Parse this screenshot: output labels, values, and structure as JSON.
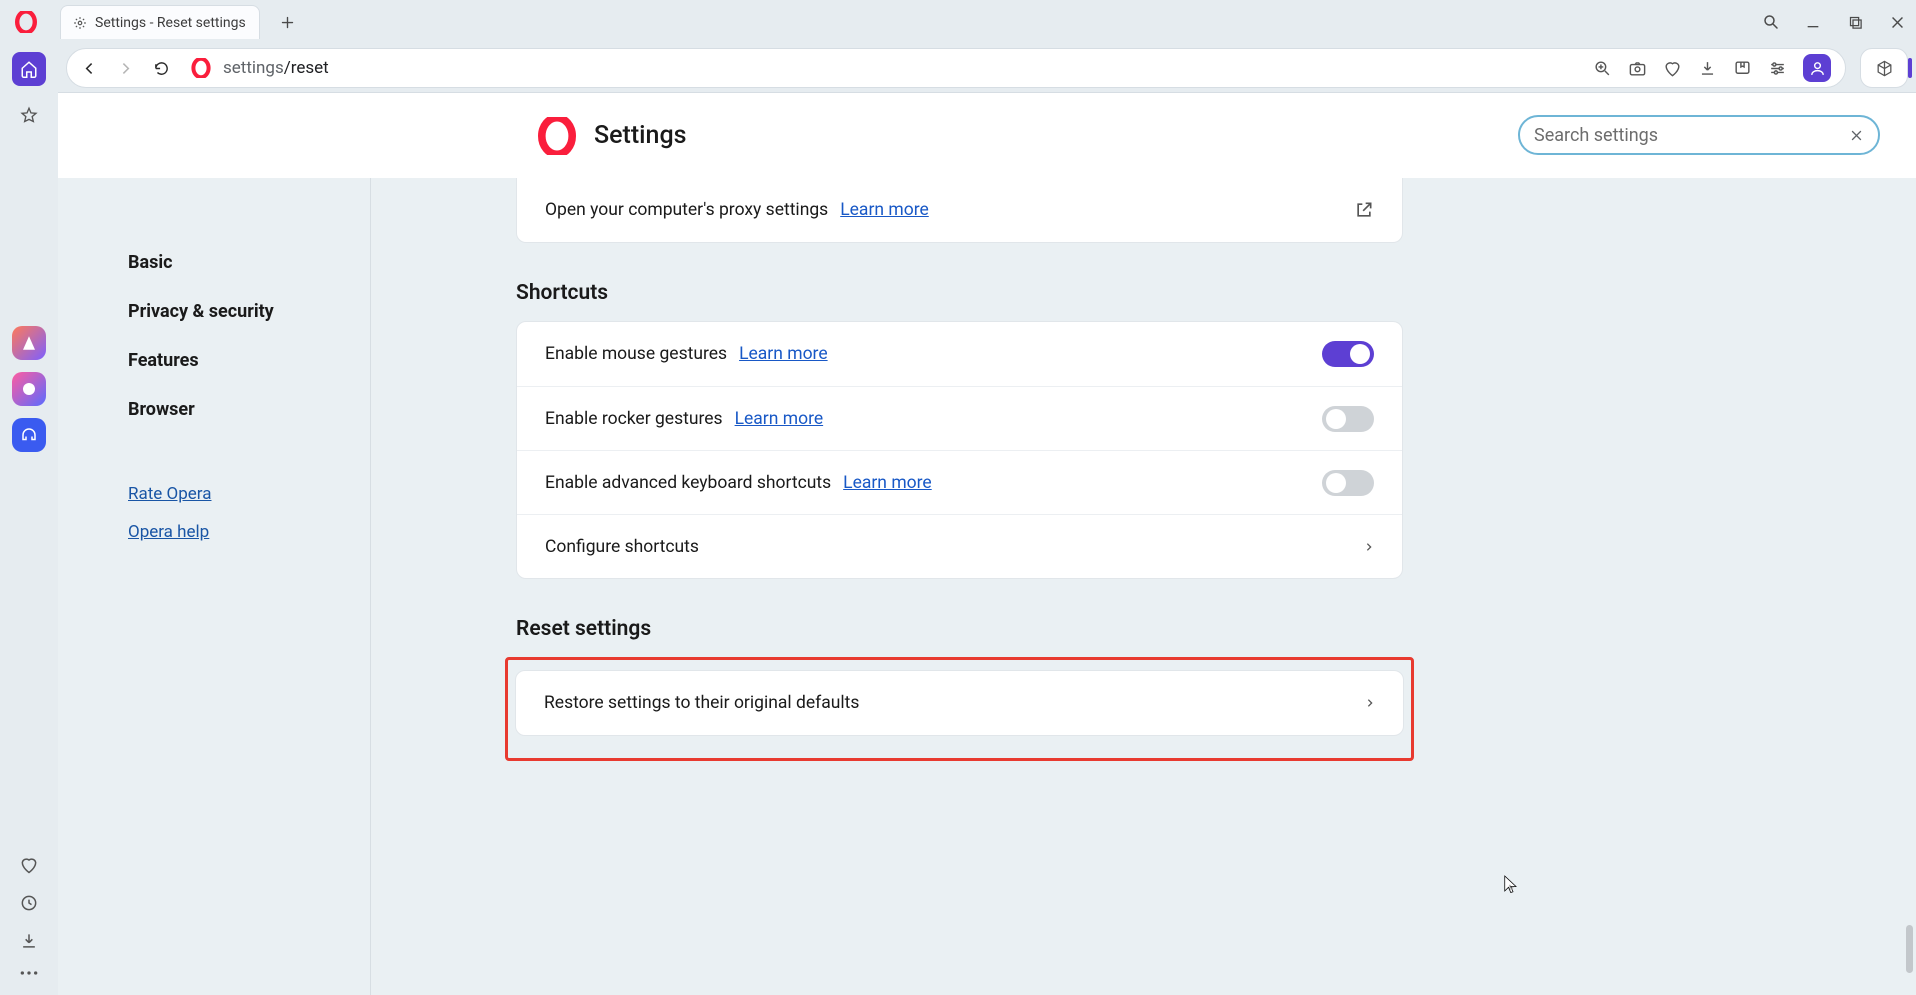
{
  "window": {
    "title": "Settings - Reset settings"
  },
  "addr": {
    "url_gray": "settings",
    "url_primary": "/reset"
  },
  "settings_header": {
    "title": "Settings",
    "search_placeholder": "Search settings"
  },
  "settings_nav": {
    "items": [
      {
        "label": "Basic"
      },
      {
        "label": "Privacy & security"
      },
      {
        "label": "Features"
      },
      {
        "label": "Browser"
      }
    ],
    "links": [
      {
        "label": "Rate Opera"
      },
      {
        "label": "Opera help"
      }
    ]
  },
  "content": {
    "proxy_row": {
      "label": "Open your computer's proxy settings",
      "learn": "Learn more"
    },
    "shortcuts_title": "Shortcuts",
    "shortcuts_rows": [
      {
        "label": "Enable mouse gestures",
        "learn": "Learn more",
        "on": true
      },
      {
        "label": "Enable rocker gestures",
        "learn": "Learn more",
        "on": false
      },
      {
        "label": "Enable advanced keyboard shortcuts",
        "learn": "Learn more",
        "on": false
      }
    ],
    "configure_label": "Configure shortcuts",
    "reset_title": "Reset settings",
    "reset_row_label": "Restore settings to their original defaults"
  }
}
